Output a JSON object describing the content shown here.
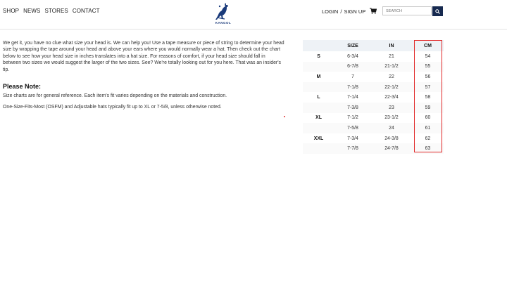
{
  "nav": {
    "items": [
      "SHOP",
      "NEWS",
      "STORES",
      "CONTACT"
    ]
  },
  "brand": {
    "logo_text": "KANGOL",
    "color": "#1a3a7a"
  },
  "account": {
    "login": "LOGIN",
    "separator": "/",
    "signup": "SIGN UP"
  },
  "cart": {
    "icon": "cart-icon"
  },
  "search": {
    "placeholder": "SEARCH",
    "button_color": "#16294f",
    "icon": "search-icon"
  },
  "content": {
    "intro": "We get it, you have no clue what size your head is. We can help you! Use a tape measure or piece of string to determine your head size by wrapping the tape around your head and above your ears where you would normally wear a hat. Then check out the chart below to see how your head size in inches translates into a hat size. For reasons of comfort, if your head size should fall in between two sizes we would suggest the larger of the two sizes. See? We're totally looking out for you here. That was an insider's tip.",
    "note_heading": "Please Note:",
    "note_1": "Size charts are for general reference. Each item's fit varies depending on the materials and construction.",
    "note_2": "One-Size-Fits-Most (OSFM) and Adjustable hats typically fit up to XL or 7-5/8, unless otherwise noted."
  },
  "size_chart": {
    "headers": [
      "",
      "SIZE",
      "IN",
      "CM"
    ],
    "rows": [
      {
        "label": "S",
        "size": "6-3/4",
        "in": "21",
        "cm": "54"
      },
      {
        "label": "",
        "size": "6-7/8",
        "in": "21-1/2",
        "cm": "55"
      },
      {
        "label": "M",
        "size": "7",
        "in": "22",
        "cm": "56"
      },
      {
        "label": "",
        "size": "7-1/8",
        "in": "22-1/2",
        "cm": "57"
      },
      {
        "label": "L",
        "size": "7-1/4",
        "in": "22-3/4",
        "cm": "58"
      },
      {
        "label": "",
        "size": "7-3/8",
        "in": "23",
        "cm": "59"
      },
      {
        "label": "XL",
        "size": "7-1/2",
        "in": "23-1/2",
        "cm": "60"
      },
      {
        "label": "",
        "size": "7-5/8",
        "in": "24",
        "cm": "61"
      },
      {
        "label": "XXL",
        "size": "7-3/4",
        "in": "24-3/8",
        "cm": "62"
      },
      {
        "label": "",
        "size": "7-7/8",
        "in": "24-7/8",
        "cm": "63"
      }
    ],
    "highlight_color": "#e22a2a"
  }
}
